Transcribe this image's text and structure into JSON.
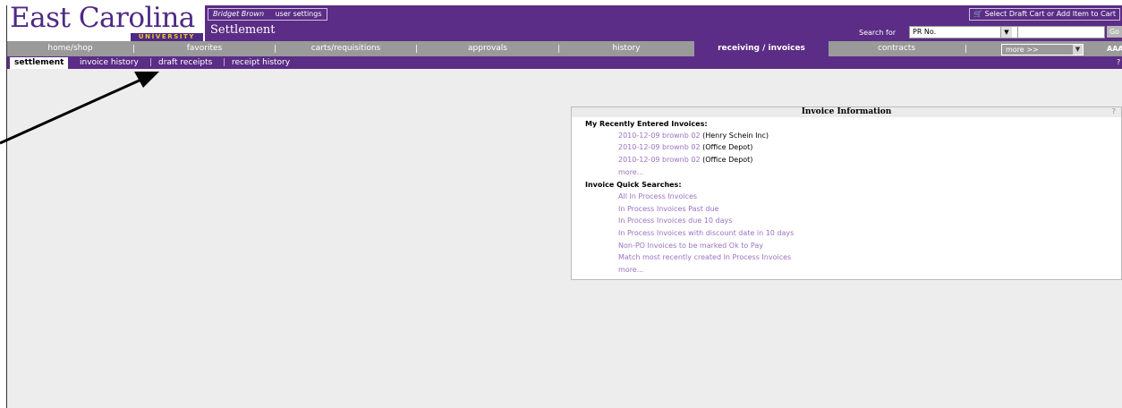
{
  "header": {
    "logo_main": "East Carolina",
    "logo_sub": "UNIVERSITY",
    "user_name": "Bridget Brown",
    "user_settings": "user settings",
    "module": "Settlement",
    "cart_label": "Select Draft Cart or Add Item to Cart",
    "search_label": "Search for",
    "search_type": "PR No.",
    "search_value": "",
    "go_label": "Go"
  },
  "nav": {
    "items": [
      "home/shop",
      "favorites",
      "carts/requisitions",
      "approvals",
      "history",
      "receiving / invoices",
      "contracts"
    ],
    "active": "receiving / invoices",
    "more_label": "more >>",
    "font_size_label": "AAA"
  },
  "subnav": {
    "items": [
      "settlement",
      "invoice history",
      "draft receipts",
      "receipt history"
    ],
    "help": "?"
  },
  "invoice_panel": {
    "title": "Invoice Information",
    "help": "?",
    "recent_heading": "My Recently Entered Invoices:",
    "recent": [
      {
        "link": "2010-12-09 brownb 02",
        "vendor": "(Henry Schein Inc)"
      },
      {
        "link": "2010-12-09 brownb 02",
        "vendor": "(Office Depot)"
      },
      {
        "link": "2010-12-09 brownb 02",
        "vendor": "(Office Depot)"
      }
    ],
    "recent_more": "more...",
    "quick_heading": "Invoice Quick Searches:",
    "quick": [
      "All In Process Invoices",
      "In Process Invoices Past due",
      "In Process Invoices due 10 days",
      "In Process Invoices with discount date in 10 days",
      "Non-PO Invoices to be marked Ok to Pay",
      "Match most recently created In Process Invoices"
    ],
    "quick_more": "more..."
  },
  "colors": {
    "brand_purple": "#5b2d86",
    "gold": "#f2c531",
    "nav_gray": "#9a9a9a",
    "link_lavender": "#9b72c4"
  }
}
